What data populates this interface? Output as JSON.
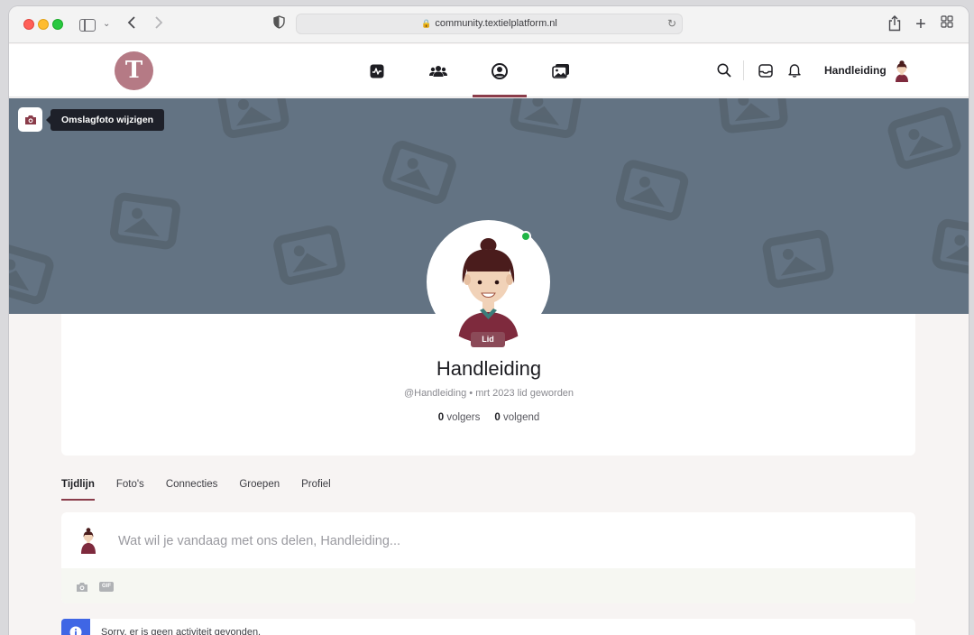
{
  "browser": {
    "url": "community.textielplatform.nl"
  },
  "header": {
    "logo_letter": "T",
    "user_name": "Handleiding",
    "nav": [
      {
        "icon": "activity-icon"
      },
      {
        "icon": "members-icon"
      },
      {
        "icon": "profile-icon",
        "active": true
      },
      {
        "icon": "photos-icon"
      }
    ]
  },
  "cover": {
    "tooltip": "Omslagfoto wijzigen",
    "color": "#637383"
  },
  "profile": {
    "name": "Handleiding",
    "role": "Lid",
    "handle": "@Handleiding",
    "joined": "mrt 2023 lid geworden",
    "followers_count": "0",
    "followers_label": "volgers",
    "following_count": "0",
    "following_label": "volgend",
    "online": true
  },
  "tabs": [
    {
      "label": "Tijdlijn",
      "active": true
    },
    {
      "label": "Foto's"
    },
    {
      "label": "Connecties"
    },
    {
      "label": "Groepen"
    },
    {
      "label": "Profiel"
    }
  ],
  "composer": {
    "placeholder": "Wat wil je vandaag met ons delen, Handleiding...",
    "gif_label": "GIF"
  },
  "notice": {
    "text": "Sorry, er is geen activiteit gevonden."
  },
  "colors": {
    "accent": "#8a3c4a",
    "badge": "#8b4a58",
    "online": "#1fb546",
    "info": "#3f66e5"
  }
}
